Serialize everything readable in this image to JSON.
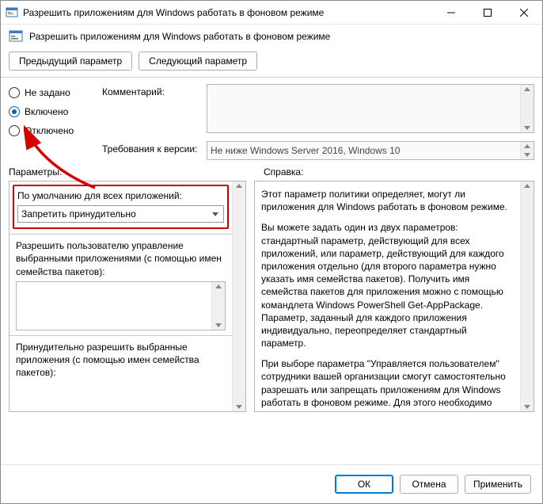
{
  "window": {
    "title": "Разрешить приложениям для Windows работать в фоновом режиме"
  },
  "header": {
    "text": "Разрешить приложениям для Windows работать в фоновом режиме"
  },
  "nav": {
    "prev": "Предыдущий параметр",
    "next": "Следующий параметр"
  },
  "state": {
    "not_configured": "Не задано",
    "enabled": "Включено",
    "disabled": "Отключено"
  },
  "comment": {
    "label": "Комментарий:",
    "value": ""
  },
  "supported": {
    "label": "Требования к версии:",
    "value": "Не ниже Windows Server 2016, Windows 10"
  },
  "sections": {
    "options": "Параметры:",
    "help": "Справка:"
  },
  "options": {
    "default_label": "По умолчанию для всех приложений:",
    "default_value": "Запретить принудительно",
    "user_label": "Разрешить пользователю управление выбранными приложениями (с помощью имен семейства пакетов):",
    "force_allow_label": "Принудительно разрешить выбранные приложения (с помощью имен семейства пакетов):"
  },
  "help": {
    "p1": "Этот параметр политики определяет, могут ли приложения для Windows работать в фоновом режиме.",
    "p2": "Вы можете задать один из двух параметров: стандартный параметр, действующий для всех приложений, или параметр, действующий для каждого приложения отдельно (для второго параметра нужно указать имя семейства пакетов). Получить имя семейства пакетов для приложения можно с помощью командлета Windows PowerShell Get-AppPackage. Параметр, заданный для каждого приложения индивидуально, переопределяет стандартный параметр.",
    "p3": "При выборе параметра \"Управляется пользователем\" сотрудники вашей организации смогут самостоятельно разрешать или запрещать приложениям для Windows работать в фоновом режиме. Для этого необходимо выбрать элементы \"Параметры\" > \"Конфиденциальность\" на устройстве."
  },
  "footer": {
    "ok": "ОК",
    "cancel": "Отмена",
    "apply": "Применить"
  }
}
